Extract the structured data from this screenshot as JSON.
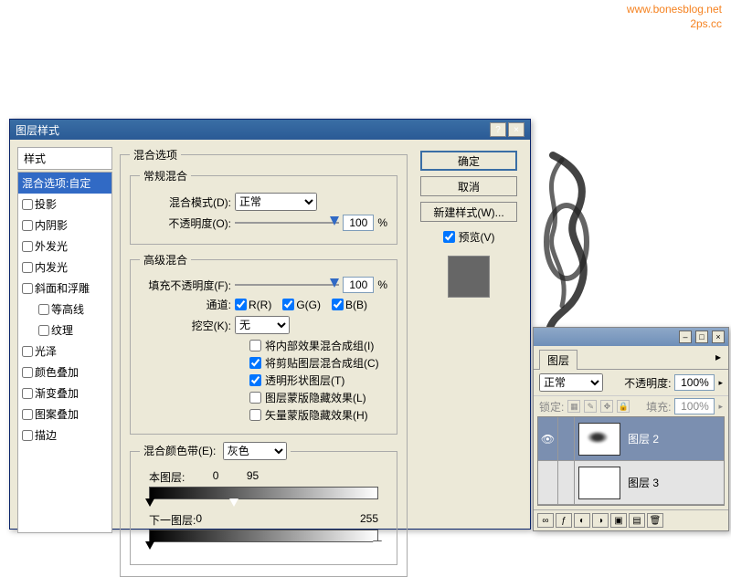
{
  "watermark": {
    "line1": "www.bonesblog.net",
    "line2": "2ps.cc"
  },
  "dialog": {
    "title": "图层样式",
    "styles_header": "样式",
    "styles_items": [
      {
        "label": "混合选项:自定",
        "checked": null,
        "selected": true
      },
      {
        "label": "投影",
        "checked": false
      },
      {
        "label": "内阴影",
        "checked": false
      },
      {
        "label": "外发光",
        "checked": false
      },
      {
        "label": "内发光",
        "checked": false
      },
      {
        "label": "斜面和浮雕",
        "checked": false
      },
      {
        "label": "等高线",
        "checked": false,
        "indent": true
      },
      {
        "label": "纹理",
        "checked": false,
        "indent": true
      },
      {
        "label": "光泽",
        "checked": false
      },
      {
        "label": "颜色叠加",
        "checked": false
      },
      {
        "label": "渐变叠加",
        "checked": false
      },
      {
        "label": "图案叠加",
        "checked": false
      },
      {
        "label": "描边",
        "checked": false
      }
    ],
    "blending_options_title": "混合选项",
    "general": {
      "legend": "常规混合",
      "mode_label": "混合模式(D):",
      "mode_value": "正常",
      "opacity_label": "不透明度(O):",
      "opacity_value": "100",
      "percent": "%"
    },
    "advanced": {
      "legend": "高级混合",
      "fill_label": "填充不透明度(F):",
      "fill_value": "100",
      "percent": "%",
      "channels_label": "通道:",
      "channel_r": "R(R)",
      "channel_g": "G(G)",
      "channel_b": "B(B)",
      "knockout_label": "挖空(K):",
      "knockout_value": "无",
      "adv_checks": [
        {
          "label": "将内部效果混合成组(I)",
          "checked": false
        },
        {
          "label": "将剪贴图层混合成组(C)",
          "checked": true
        },
        {
          "label": "透明形状图层(T)",
          "checked": true
        },
        {
          "label": "图层蒙版隐藏效果(L)",
          "checked": false
        },
        {
          "label": "矢量蒙版隐藏效果(H)",
          "checked": false
        }
      ]
    },
    "blend_if": {
      "legend_prefix": "混合颜色带(E):",
      "channel_value": "灰色",
      "this_label": "本图层:",
      "this_lo": "0",
      "this_hi": "95",
      "under_label": "下一图层:",
      "under_lo": "0",
      "under_hi": "255"
    },
    "buttons": {
      "ok": "确定",
      "cancel": "取消",
      "new_style": "新建样式(W)...",
      "preview": "预览(V)"
    }
  },
  "layers_panel": {
    "tab": "图层",
    "mode_value": "正常",
    "opacity_label": "不透明度:",
    "opacity_value": "100%",
    "lock_label": "锁定:",
    "fill_label": "填充:",
    "fill_value": "100%",
    "layers": [
      {
        "name": "图层 2",
        "visible": true,
        "selected": true
      },
      {
        "name": "图层 3",
        "visible": false,
        "selected": false
      }
    ]
  }
}
